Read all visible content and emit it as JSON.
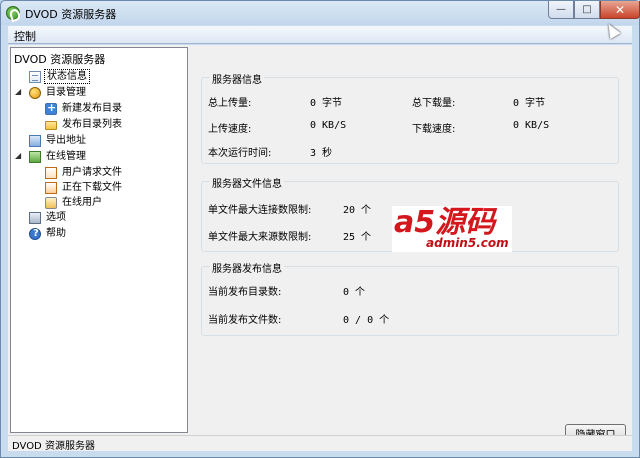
{
  "window": {
    "title": "DVOD 资源服务器"
  },
  "menubar": {
    "items": [
      "控制"
    ]
  },
  "tree": {
    "root": "DVOD 资源服务器",
    "nodes": {
      "status": "状态信息",
      "dir_mgmt": "目录管理",
      "new_dir": "新建发布目录",
      "dir_list": "发布目录列表",
      "export": "导出地址",
      "online_mgmt": "在线管理",
      "user_requests": "用户请求文件",
      "downloading": "正在下载文件",
      "online_users": "在线用户",
      "options": "选项",
      "help": "帮助"
    }
  },
  "server_info": {
    "title": "服务器信息",
    "upload_total_label": "总上传量:",
    "upload_total_value": "0 字节",
    "download_total_label": "总下载量:",
    "download_total_value": "0 字节",
    "upload_speed_label": "上传速度:",
    "upload_speed_value": "0 KB/S",
    "download_speed_label": "下载速度:",
    "download_speed_value": "0 KB/S",
    "uptime_label": "本次运行时间:",
    "uptime_value": "3 秒"
  },
  "file_info": {
    "title": "服务器文件信息",
    "max_conn_label": "单文件最大连接数限制:",
    "max_conn_value": "20 个",
    "max_src_label": "单文件最大来源数限制:",
    "max_src_value": "25 个"
  },
  "publish_info": {
    "title": "服务器发布信息",
    "dirs_label": "当前发布目录数:",
    "dirs_value": "0 个",
    "files_label": "当前发布文件数:",
    "files_value": "0 / 0 个"
  },
  "watermark": {
    "main": "a5源码",
    "site": "admin5.com"
  },
  "buttons": {
    "hide": "隐藏窗口"
  },
  "statusbar": {
    "text": "DVOD 资源服务器"
  }
}
